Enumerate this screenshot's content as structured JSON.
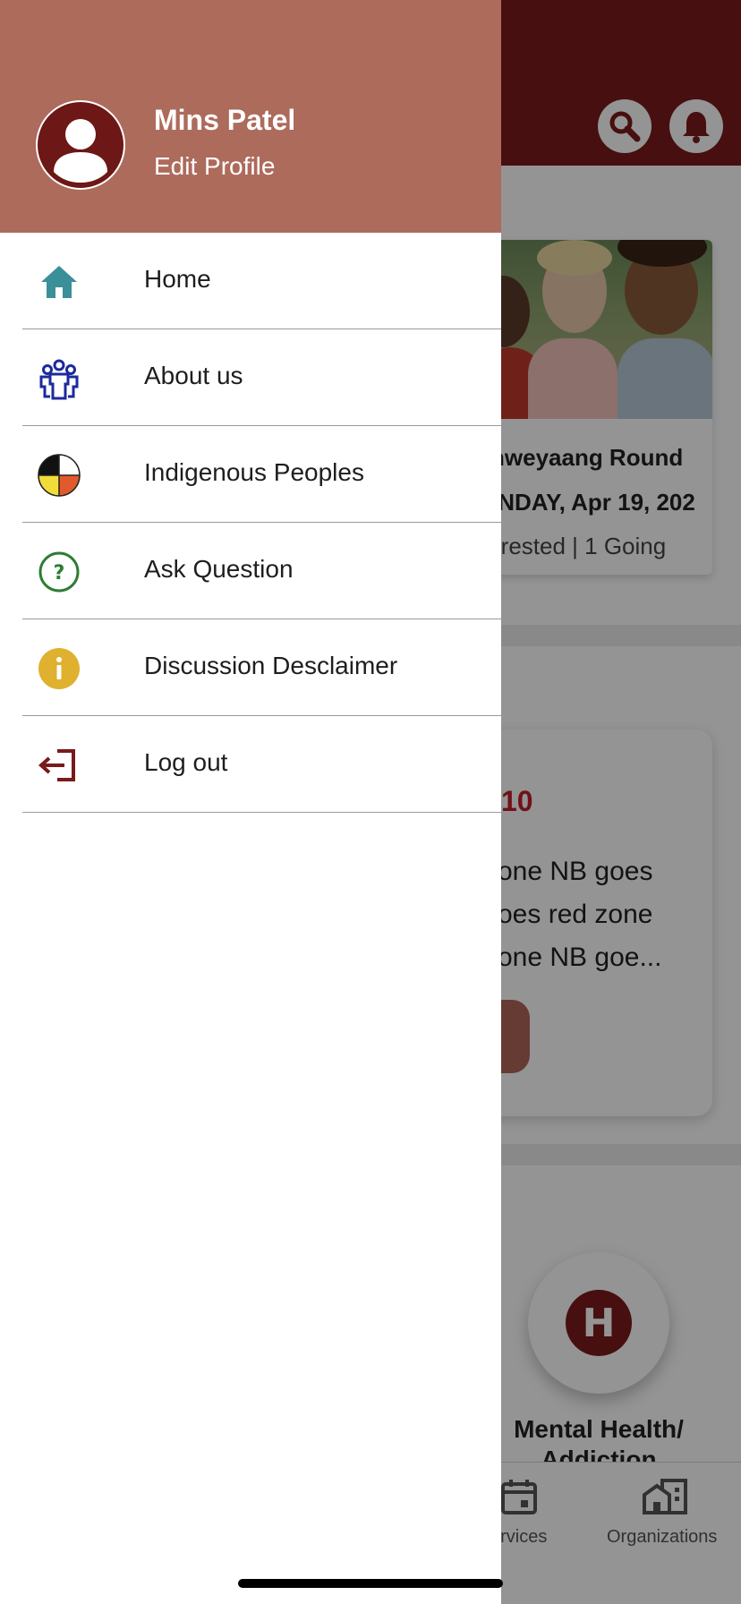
{
  "drawer": {
    "user_name": "Mins Patel",
    "edit_profile": "Edit Profile",
    "menu": [
      {
        "label": "Home",
        "icon": "home-icon",
        "color": "#3b8f99"
      },
      {
        "label": "About us",
        "icon": "group-icon",
        "color": "#1c2a9c"
      },
      {
        "label": "Indigenous Peoples",
        "icon": "medicine-wheel-icon"
      },
      {
        "label": "Ask Question",
        "icon": "question-circle-icon",
        "color": "#2e7d32"
      },
      {
        "label": "Discussion Desclaimer",
        "icon": "info-icon",
        "color": "#e0b02f"
      },
      {
        "label": "Log out",
        "icon": "logout-icon",
        "color": "#7a1a1a"
      }
    ]
  },
  "background": {
    "event": {
      "title": "nweyaang Round",
      "date": "ONDAY, Apr 19, 202",
      "stats": "terested | 1 Going"
    },
    "news": {
      "tag": "10",
      "lines": [
        "one NB goes",
        "oes red zone",
        "one NB goe..."
      ]
    },
    "service": {
      "label": "Mental Health/ Addiction",
      "icon_letter": "H"
    },
    "tabs": [
      {
        "label": "ervices",
        "icon": "calendar-icon"
      },
      {
        "label": "Organizations",
        "icon": "buildings-icon"
      }
    ]
  },
  "colors": {
    "header_bg": "#7a1a1a",
    "drawer_header_bg": "#ad6b5c",
    "accent_red": "#c0202a"
  }
}
